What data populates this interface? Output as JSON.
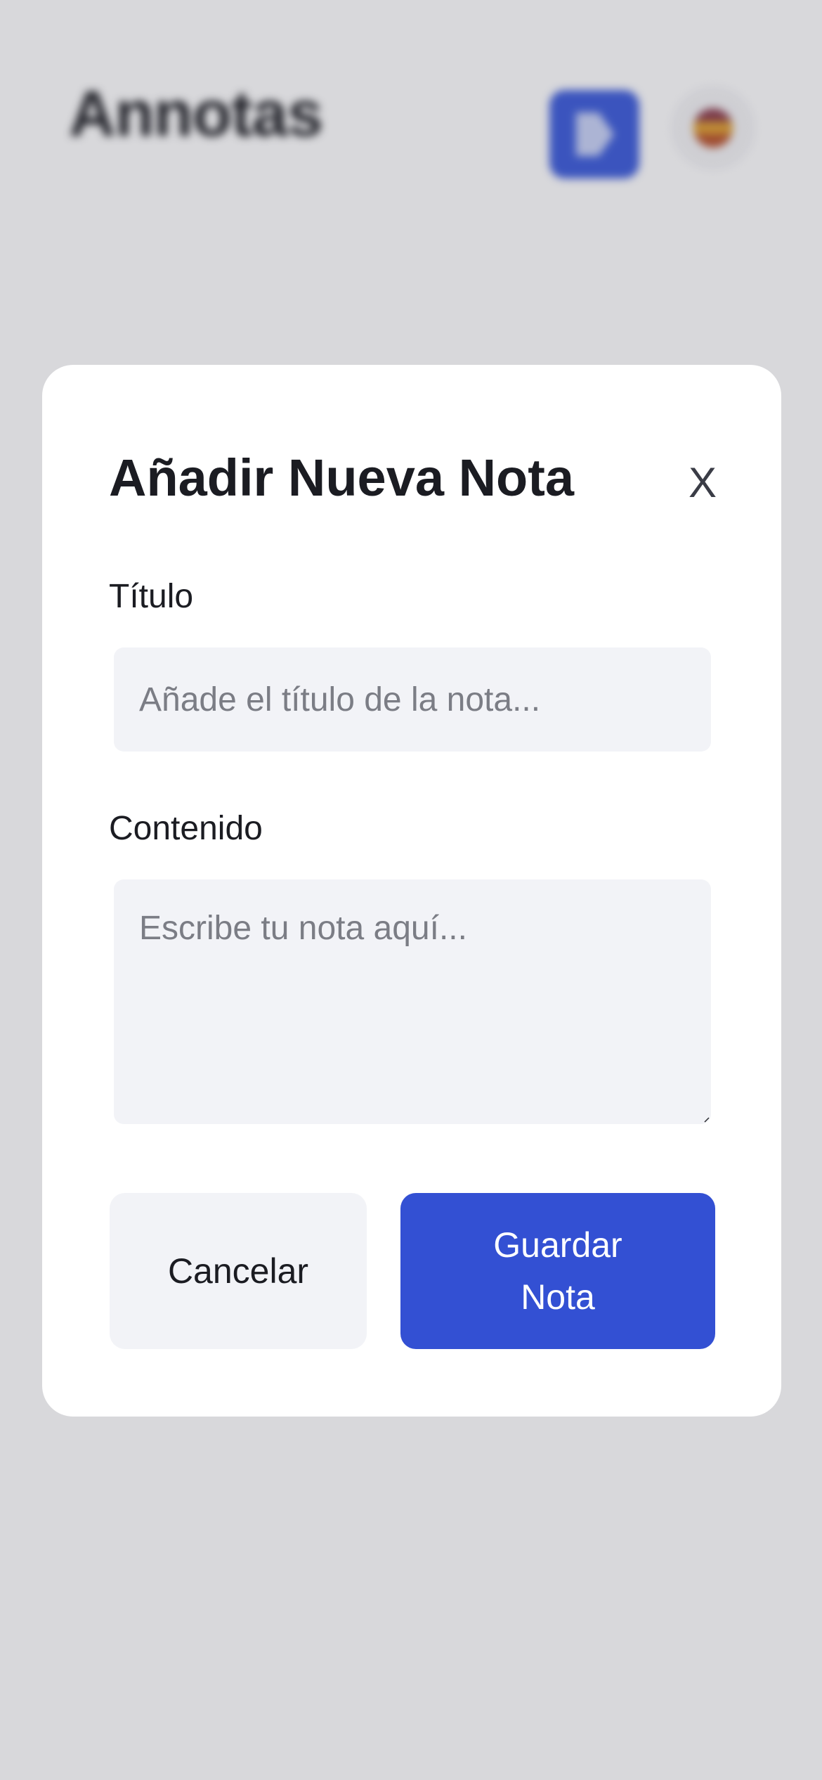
{
  "background": {
    "app_title": "Annotas",
    "logout_icon": "logout-icon",
    "language_flag_icon": "spain-flag-icon"
  },
  "modal": {
    "title": "Añadir Nueva Nota",
    "close_label": "X",
    "title_field": {
      "label": "Título",
      "placeholder": "Añade el título de la nota...",
      "value": ""
    },
    "content_field": {
      "label": "Contenido",
      "placeholder": "Escribe tu nota aquí...",
      "value": ""
    },
    "cancel_label": "Cancelar",
    "save_label": "Guardar Nota"
  },
  "colors": {
    "primary": "#3350d3",
    "input_bg": "#f2f3f7",
    "backdrop": "#dadbdf",
    "text": "#1b1c22"
  }
}
